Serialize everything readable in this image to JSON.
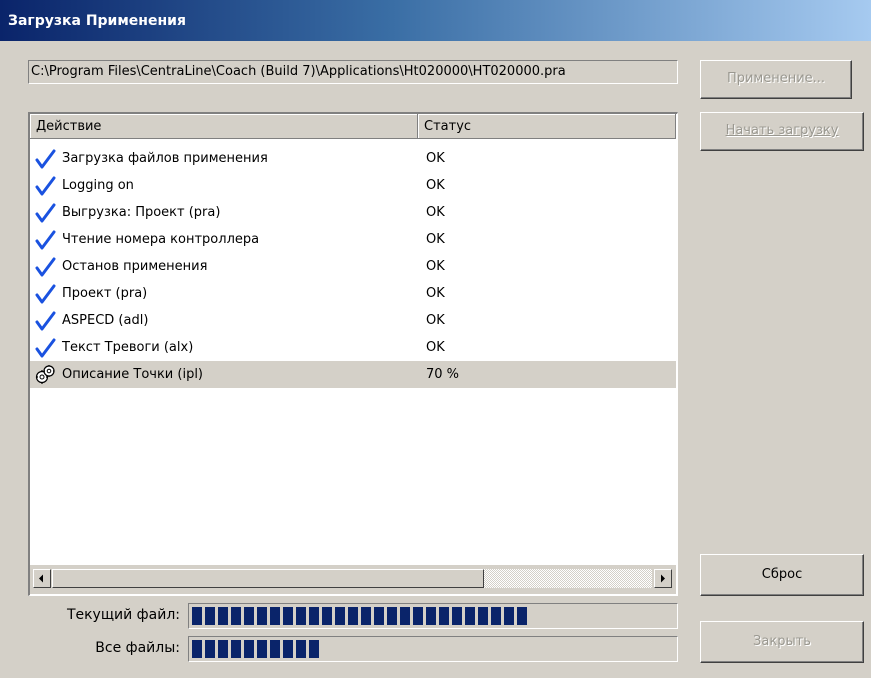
{
  "window": {
    "title": "Загрузка Применения"
  },
  "path": {
    "value": "C:\\Program Files\\CentraLine\\Coach (Build 7)\\Applications\\Ht020000\\HT020000.pra"
  },
  "buttons": {
    "application": "Применение...",
    "start_download": "Начать загрузку",
    "reset": "Сброс",
    "close": "Закрыть"
  },
  "table": {
    "columns": [
      "Действие",
      "Статус"
    ],
    "rows": [
      {
        "action": "Загрузка файлов применения",
        "status": "OK",
        "icon": "checkmark-icon"
      },
      {
        "action": "Logging on",
        "status": "OK",
        "icon": "checkmark-icon"
      },
      {
        "action": "Выгрузка: Проект (pra)",
        "status": "OK",
        "icon": "checkmark-icon"
      },
      {
        "action": "Чтение номера контроллера",
        "status": "OK",
        "icon": "checkmark-icon"
      },
      {
        "action": "Останов применения",
        "status": "OK",
        "icon": "checkmark-icon"
      },
      {
        "action": "Проект (pra)",
        "status": "OK",
        "icon": "checkmark-icon"
      },
      {
        "action": "ASPECD (adl)",
        "status": "OK",
        "icon": "checkmark-icon"
      },
      {
        "action": "Текст Тревоги (alx)",
        "status": "OK",
        "icon": "checkmark-icon"
      },
      {
        "action": "Описание Точки (ipl)",
        "status": "70 %",
        "icon": "gears-icon",
        "selected": true
      }
    ]
  },
  "progress": {
    "current_label": "Текущий файл:",
    "current_value": 0.7,
    "all_label": "Все файлы:",
    "all_value": 0.27
  },
  "colors": {
    "progress": "#0a246a",
    "title_bar": "#0a246a"
  }
}
